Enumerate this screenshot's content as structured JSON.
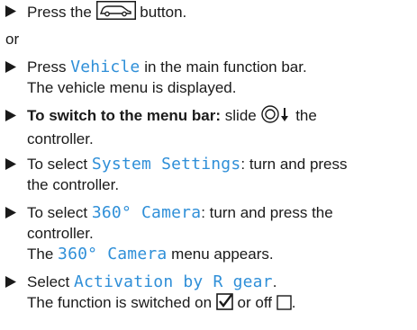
{
  "colors": {
    "text": "#1a1a1a",
    "keyword": "#2f8fd8"
  },
  "steps": [
    {
      "before": "Press the",
      "icon": "vehicle-button-icon",
      "after": "button."
    },
    {
      "or": "or"
    },
    {
      "before": "Press",
      "keyword": "Vehicle",
      "after": "in the main function bar.",
      "result": "The vehicle menu is displayed."
    },
    {
      "bold": "To switch to the menu bar:",
      "before": "slide",
      "icon": "controller-slide-down-icon",
      "after": "the",
      "line2": "controller."
    },
    {
      "before": "To select",
      "keyword": "System Settings",
      "after": ": turn and press",
      "line2": "the controller."
    },
    {
      "before": "To select",
      "keyword": "360° Camera",
      "after": ": turn and press the",
      "line2": "controller.",
      "result_keyword": "360° Camera",
      "result_before": "The",
      "result_after": "menu appears."
    },
    {
      "before": "Select",
      "keyword": "Activation by R gear",
      "after": ".",
      "result_before": "The function is switched on",
      "on_icon": "checkbox-checked-icon",
      "result_middle": "or off",
      "off_icon": "checkbox-empty-icon",
      "result_after": "."
    }
  ]
}
